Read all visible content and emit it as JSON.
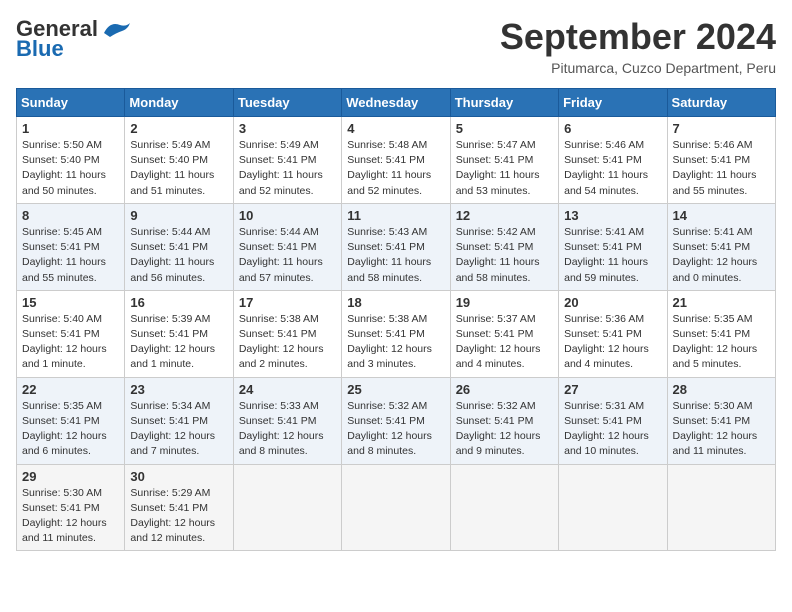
{
  "header": {
    "logo_general": "General",
    "logo_blue": "Blue",
    "month": "September 2024",
    "location": "Pitumarca, Cuzco Department, Peru"
  },
  "days": [
    "Sunday",
    "Monday",
    "Tuesday",
    "Wednesday",
    "Thursday",
    "Friday",
    "Saturday"
  ],
  "weeks": [
    [
      {
        "day": "1",
        "sunrise": "5:50 AM",
        "sunset": "5:40 PM",
        "daylight": "11 hours and 50 minutes."
      },
      {
        "day": "2",
        "sunrise": "5:49 AM",
        "sunset": "5:40 PM",
        "daylight": "11 hours and 51 minutes."
      },
      {
        "day": "3",
        "sunrise": "5:49 AM",
        "sunset": "5:41 PM",
        "daylight": "11 hours and 52 minutes."
      },
      {
        "day": "4",
        "sunrise": "5:48 AM",
        "sunset": "5:41 PM",
        "daylight": "11 hours and 52 minutes."
      },
      {
        "day": "5",
        "sunrise": "5:47 AM",
        "sunset": "5:41 PM",
        "daylight": "11 hours and 53 minutes."
      },
      {
        "day": "6",
        "sunrise": "5:46 AM",
        "sunset": "5:41 PM",
        "daylight": "11 hours and 54 minutes."
      },
      {
        "day": "7",
        "sunrise": "5:46 AM",
        "sunset": "5:41 PM",
        "daylight": "11 hours and 55 minutes."
      }
    ],
    [
      {
        "day": "8",
        "sunrise": "5:45 AM",
        "sunset": "5:41 PM",
        "daylight": "11 hours and 55 minutes."
      },
      {
        "day": "9",
        "sunrise": "5:44 AM",
        "sunset": "5:41 PM",
        "daylight": "11 hours and 56 minutes."
      },
      {
        "day": "10",
        "sunrise": "5:44 AM",
        "sunset": "5:41 PM",
        "daylight": "11 hours and 57 minutes."
      },
      {
        "day": "11",
        "sunrise": "5:43 AM",
        "sunset": "5:41 PM",
        "daylight": "11 hours and 58 minutes."
      },
      {
        "day": "12",
        "sunrise": "5:42 AM",
        "sunset": "5:41 PM",
        "daylight": "11 hours and 58 minutes."
      },
      {
        "day": "13",
        "sunrise": "5:41 AM",
        "sunset": "5:41 PM",
        "daylight": "11 hours and 59 minutes."
      },
      {
        "day": "14",
        "sunrise": "5:41 AM",
        "sunset": "5:41 PM",
        "daylight": "12 hours and 0 minutes."
      }
    ],
    [
      {
        "day": "15",
        "sunrise": "5:40 AM",
        "sunset": "5:41 PM",
        "daylight": "12 hours and 1 minute."
      },
      {
        "day": "16",
        "sunrise": "5:39 AM",
        "sunset": "5:41 PM",
        "daylight": "12 hours and 1 minute."
      },
      {
        "day": "17",
        "sunrise": "5:38 AM",
        "sunset": "5:41 PM",
        "daylight": "12 hours and 2 minutes."
      },
      {
        "day": "18",
        "sunrise": "5:38 AM",
        "sunset": "5:41 PM",
        "daylight": "12 hours and 3 minutes."
      },
      {
        "day": "19",
        "sunrise": "5:37 AM",
        "sunset": "5:41 PM",
        "daylight": "12 hours and 4 minutes."
      },
      {
        "day": "20",
        "sunrise": "5:36 AM",
        "sunset": "5:41 PM",
        "daylight": "12 hours and 4 minutes."
      },
      {
        "day": "21",
        "sunrise": "5:35 AM",
        "sunset": "5:41 PM",
        "daylight": "12 hours and 5 minutes."
      }
    ],
    [
      {
        "day": "22",
        "sunrise": "5:35 AM",
        "sunset": "5:41 PM",
        "daylight": "12 hours and 6 minutes."
      },
      {
        "day": "23",
        "sunrise": "5:34 AM",
        "sunset": "5:41 PM",
        "daylight": "12 hours and 7 minutes."
      },
      {
        "day": "24",
        "sunrise": "5:33 AM",
        "sunset": "5:41 PM",
        "daylight": "12 hours and 8 minutes."
      },
      {
        "day": "25",
        "sunrise": "5:32 AM",
        "sunset": "5:41 PM",
        "daylight": "12 hours and 8 minutes."
      },
      {
        "day": "26",
        "sunrise": "5:32 AM",
        "sunset": "5:41 PM",
        "daylight": "12 hours and 9 minutes."
      },
      {
        "day": "27",
        "sunrise": "5:31 AM",
        "sunset": "5:41 PM",
        "daylight": "12 hours and 10 minutes."
      },
      {
        "day": "28",
        "sunrise": "5:30 AM",
        "sunset": "5:41 PM",
        "daylight": "12 hours and 11 minutes."
      }
    ],
    [
      {
        "day": "29",
        "sunrise": "5:30 AM",
        "sunset": "5:41 PM",
        "daylight": "12 hours and 11 minutes."
      },
      {
        "day": "30",
        "sunrise": "5:29 AM",
        "sunset": "5:41 PM",
        "daylight": "12 hours and 12 minutes."
      },
      null,
      null,
      null,
      null,
      null
    ]
  ]
}
